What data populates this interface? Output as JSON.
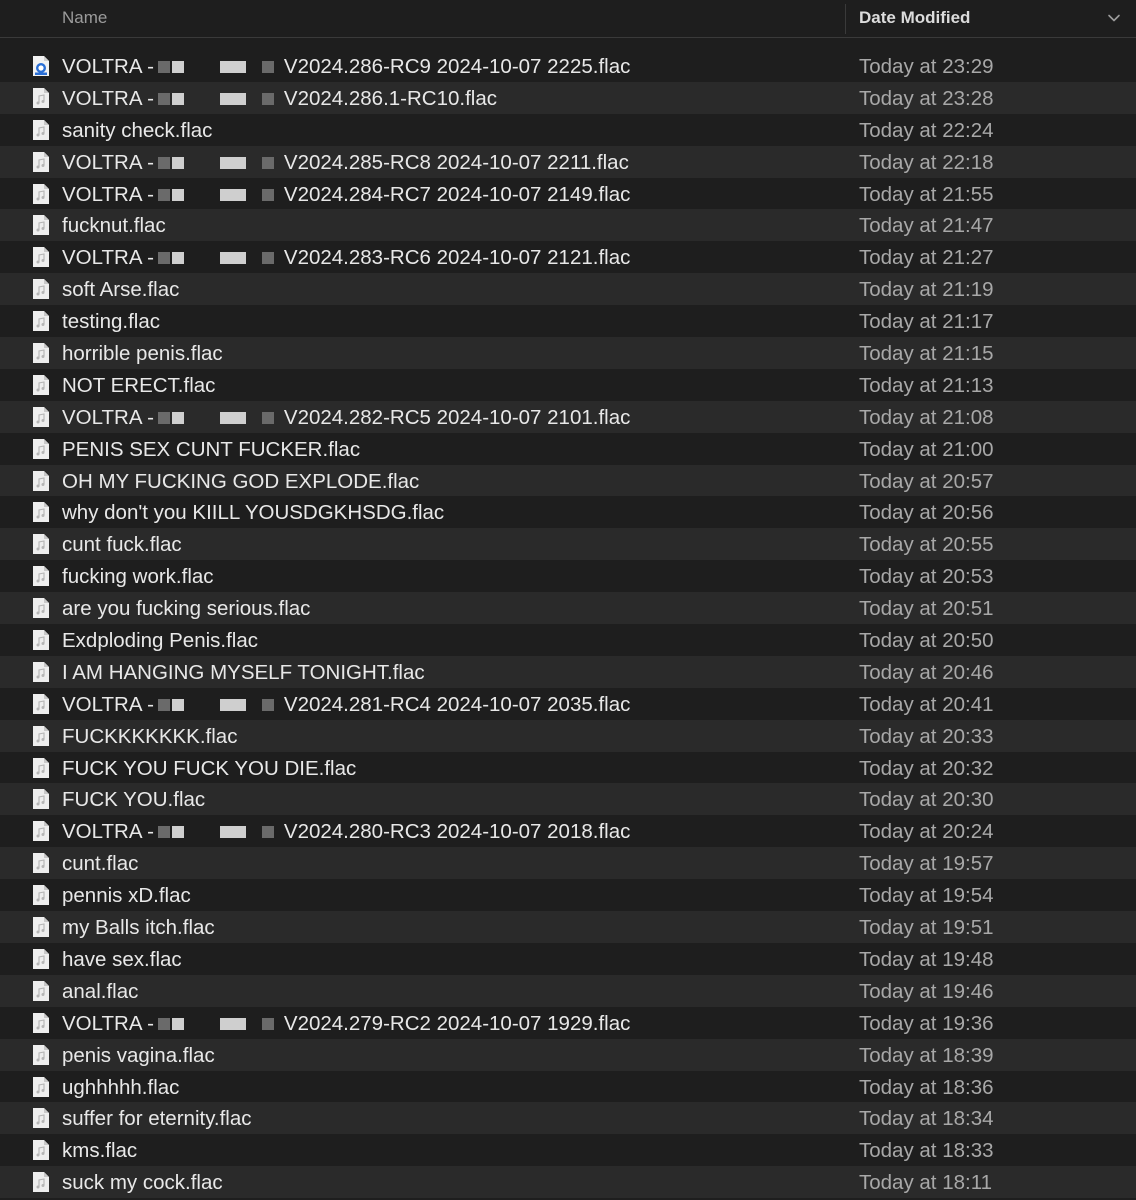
{
  "header": {
    "name_label": "Name",
    "date_label": "Date Modified"
  },
  "files": [
    {
      "prefix": "VOLTRA -",
      "name": "V2024.286-RC9 2024-10-07 2225.flac",
      "date": "Today at 23:29",
      "redacted": true,
      "icon": "app-document-icon"
    },
    {
      "prefix": "VOLTRA -",
      "name": "V2024.286.1-RC10.flac",
      "date": "Today at 23:28",
      "redacted": true,
      "icon": "audio-file-icon"
    },
    {
      "prefix": "",
      "name": "sanity check.flac",
      "date": "Today at 22:24",
      "redacted": false,
      "icon": "audio-file-icon"
    },
    {
      "prefix": "VOLTRA -",
      "name": "V2024.285-RC8 2024-10-07 2211.flac",
      "date": "Today at 22:18",
      "redacted": true,
      "icon": "audio-file-icon"
    },
    {
      "prefix": "VOLTRA -",
      "name": "V2024.284-RC7 2024-10-07 2149.flac",
      "date": "Today at 21:55",
      "redacted": true,
      "icon": "audio-file-icon"
    },
    {
      "prefix": "",
      "name": "fucknut.flac",
      "date": "Today at 21:47",
      "redacted": false,
      "icon": "audio-file-icon"
    },
    {
      "prefix": "VOLTRA -",
      "name": "V2024.283-RC6 2024-10-07 2121.flac",
      "date": "Today at 21:27",
      "redacted": true,
      "icon": "audio-file-icon"
    },
    {
      "prefix": "",
      "name": "soft Arse.flac",
      "date": "Today at 21:19",
      "redacted": false,
      "icon": "audio-file-icon"
    },
    {
      "prefix": "",
      "name": "testing.flac",
      "date": "Today at 21:17",
      "redacted": false,
      "icon": "audio-file-icon"
    },
    {
      "prefix": "",
      "name": "horrible penis.flac",
      "date": "Today at 21:15",
      "redacted": false,
      "icon": "audio-file-icon"
    },
    {
      "prefix": "",
      "name": "NOT ERECT.flac",
      "date": "Today at 21:13",
      "redacted": false,
      "icon": "audio-file-icon"
    },
    {
      "prefix": "VOLTRA -",
      "name": "V2024.282-RC5 2024-10-07 2101.flac",
      "date": "Today at 21:08",
      "redacted": true,
      "icon": "audio-file-icon"
    },
    {
      "prefix": "",
      "name": "PENIS SEX CUNT FUCKER.flac",
      "date": "Today at 21:00",
      "redacted": false,
      "icon": "audio-file-icon"
    },
    {
      "prefix": "",
      "name": "OH MY FUCKING GOD EXPLODE.flac",
      "date": "Today at 20:57",
      "redacted": false,
      "icon": "audio-file-icon"
    },
    {
      "prefix": "",
      "name": "why don't you KIILL YOUSDGKHSDG.flac",
      "date": "Today at 20:56",
      "redacted": false,
      "icon": "audio-file-icon"
    },
    {
      "prefix": "",
      "name": "cunt fuck.flac",
      "date": "Today at 20:55",
      "redacted": false,
      "icon": "audio-file-icon"
    },
    {
      "prefix": "",
      "name": "fucking work.flac",
      "date": "Today at 20:53",
      "redacted": false,
      "icon": "audio-file-icon"
    },
    {
      "prefix": "",
      "name": "are you fucking serious.flac",
      "date": "Today at 20:51",
      "redacted": false,
      "icon": "audio-file-icon"
    },
    {
      "prefix": "",
      "name": "Exdploding Penis.flac",
      "date": "Today at 20:50",
      "redacted": false,
      "icon": "audio-file-icon"
    },
    {
      "prefix": "",
      "name": "I AM HANGING MYSELF TONIGHT.flac",
      "date": "Today at 20:46",
      "redacted": false,
      "icon": "audio-file-icon"
    },
    {
      "prefix": "VOLTRA -",
      "name": "V2024.281-RC4 2024-10-07 2035.flac",
      "date": "Today at 20:41",
      "redacted": true,
      "icon": "audio-file-icon"
    },
    {
      "prefix": "",
      "name": "FUCKKKKKKK.flac",
      "date": "Today at 20:33",
      "redacted": false,
      "icon": "audio-file-icon"
    },
    {
      "prefix": "",
      "name": "FUCK YOU FUCK YOU DIE.flac",
      "date": "Today at 20:32",
      "redacted": false,
      "icon": "audio-file-icon"
    },
    {
      "prefix": "",
      "name": "FUCK YOU.flac",
      "date": "Today at 20:30",
      "redacted": false,
      "icon": "audio-file-icon"
    },
    {
      "prefix": "VOLTRA -",
      "name": "V2024.280-RC3 2024-10-07 2018.flac",
      "date": "Today at 20:24",
      "redacted": true,
      "icon": "audio-file-icon"
    },
    {
      "prefix": "",
      "name": "cunt.flac",
      "date": "Today at 19:57",
      "redacted": false,
      "icon": "audio-file-icon"
    },
    {
      "prefix": "",
      "name": "pennis xD.flac",
      "date": "Today at 19:54",
      "redacted": false,
      "icon": "audio-file-icon"
    },
    {
      "prefix": "",
      "name": "my Balls itch.flac",
      "date": "Today at 19:51",
      "redacted": false,
      "icon": "audio-file-icon"
    },
    {
      "prefix": "",
      "name": "have sex.flac",
      "date": "Today at 19:48",
      "redacted": false,
      "icon": "audio-file-icon"
    },
    {
      "prefix": "",
      "name": "anal.flac",
      "date": "Today at 19:46",
      "redacted": false,
      "icon": "audio-file-icon"
    },
    {
      "prefix": "VOLTRA -",
      "name": "V2024.279-RC2 2024-10-07 1929.flac",
      "date": "Today at 19:36",
      "redacted": true,
      "icon": "audio-file-icon"
    },
    {
      "prefix": "",
      "name": "penis vagina.flac",
      "date": "Today at 18:39",
      "redacted": false,
      "icon": "audio-file-icon"
    },
    {
      "prefix": "",
      "name": "ughhhhh.flac",
      "date": "Today at 18:36",
      "redacted": false,
      "icon": "audio-file-icon"
    },
    {
      "prefix": "",
      "name": "suffer for eternity.flac",
      "date": "Today at 18:34",
      "redacted": false,
      "icon": "audio-file-icon"
    },
    {
      "prefix": "",
      "name": "kms.flac",
      "date": "Today at 18:33",
      "redacted": false,
      "icon": "audio-file-icon"
    },
    {
      "prefix": "",
      "name": "suck my cock.flac",
      "date": "Today at 18:11",
      "redacted": false,
      "icon": "audio-file-icon"
    }
  ]
}
